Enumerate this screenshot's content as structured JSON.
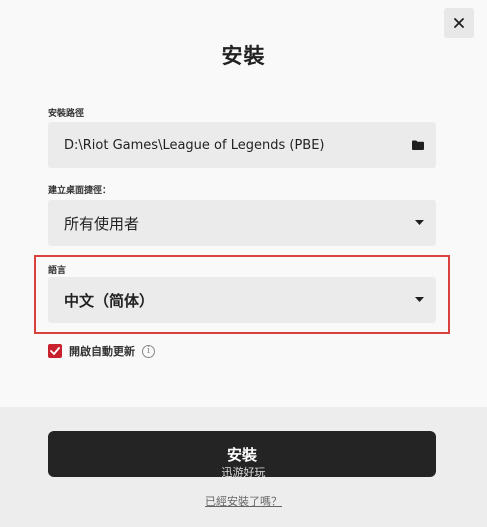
{
  "dialog": {
    "title": "安裝",
    "close_icon": "close-icon"
  },
  "install_path": {
    "label": "安裝路徑",
    "value": "D:\\Riot Games\\League of Legends (PBE)",
    "icon": "folder-icon"
  },
  "shortcut": {
    "label": "建立桌面捷徑：",
    "selected": "所有使用者",
    "icon": "chevron-down-icon"
  },
  "language": {
    "label": "語言",
    "selected": "中文（简体）",
    "icon": "chevron-down-icon",
    "highlight_color": "#d9413a"
  },
  "auto_update": {
    "label": "開啟自動更新",
    "checked": true,
    "checkbox_color": "#c8202c",
    "info_icon": "info-icon",
    "info_glyph": "i"
  },
  "footer": {
    "install_label": "安裝",
    "already_installed_link": "已經安裝了嗎？"
  },
  "watermark": "迅游好玩"
}
